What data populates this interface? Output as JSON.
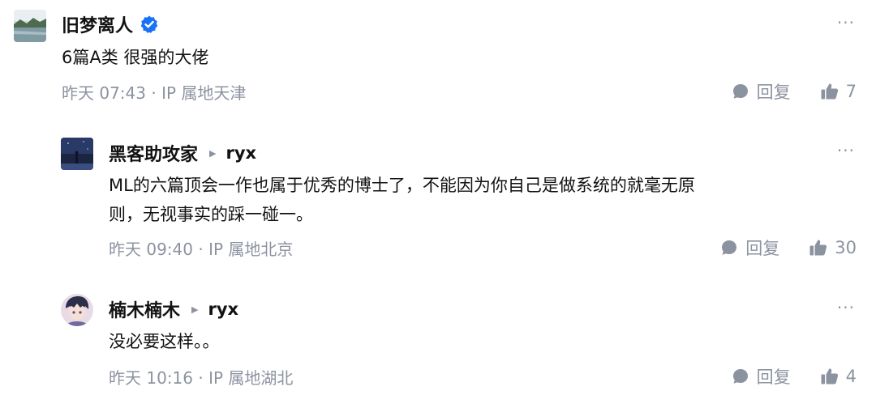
{
  "colors": {
    "text": "#121212",
    "meta": "#8c93a0",
    "verified": "#1772f6"
  },
  "comments": [
    {
      "author": "旧梦离人",
      "verified": true,
      "text": "6篇A类 很强的大佬",
      "time": "昨天 07:43 · IP 属地天津",
      "reply_label": "回复",
      "likes": "7",
      "more": "···"
    },
    {
      "author": "黑客助攻家",
      "reply_to": "ryx",
      "text": "ML的六篇顶会一作也属于优秀的博士了，不能因为你自己是做系统的就毫无原\n则，无视事实的踩一碰一。",
      "time": "昨天 09:40 · IP 属地北京",
      "reply_label": "回复",
      "likes": "30",
      "more": "···"
    },
    {
      "author": "楠木楠木",
      "reply_to": "ryx",
      "text": "没必要这样。。",
      "time": "昨天 10:16 · IP 属地湖北",
      "reply_label": "回复",
      "likes": "4",
      "more": "···"
    }
  ]
}
